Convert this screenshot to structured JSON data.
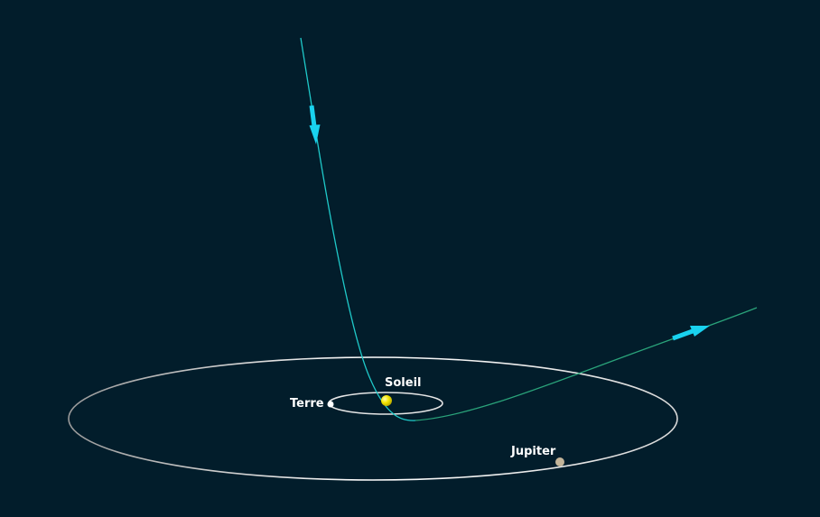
{
  "labels": {
    "sun": "Soleil",
    "earth": "Terre",
    "jupiter": "Jupiter"
  },
  "colors": {
    "background": "#021d2b",
    "incoming_trajectory": "#1fc9c9",
    "outgoing_trajectory": "#2aa37a",
    "arrow": "#19d2ef",
    "orbit": "#e6e6e6",
    "sun": "#f5e600",
    "earth": "#ffffff",
    "jupiter": "#c4b59a",
    "label_text": "#ffffff"
  }
}
